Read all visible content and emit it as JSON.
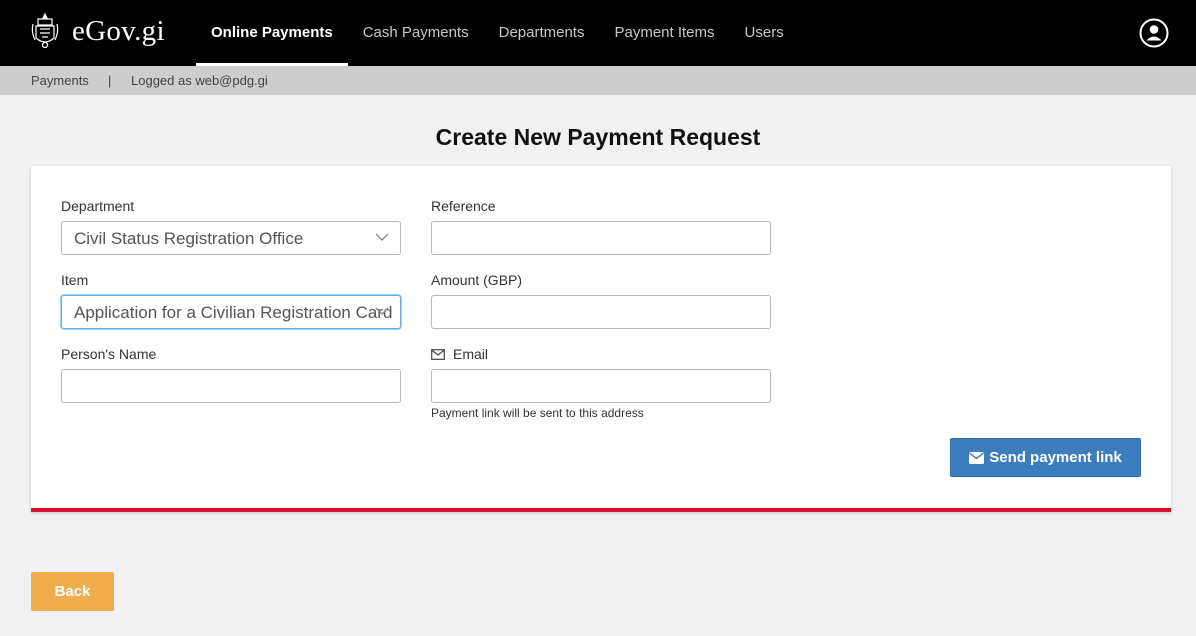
{
  "header": {
    "brand": "eGov.gi",
    "nav": [
      {
        "label": "Online Payments",
        "active": true
      },
      {
        "label": "Cash Payments",
        "active": false
      },
      {
        "label": "Departments",
        "active": false
      },
      {
        "label": "Payment Items",
        "active": false
      },
      {
        "label": "Users",
        "active": false
      }
    ],
    "user_icon": "user-circle-icon"
  },
  "subbar": {
    "section": "Payments",
    "separator": "|",
    "logged_as": "Logged as web@pdg.gi"
  },
  "page": {
    "title": "Create New Payment Request"
  },
  "form": {
    "department": {
      "label": "Department",
      "value": "Civil Status Registration Office"
    },
    "item": {
      "label": "Item",
      "value": "Application for a Civilian Registration Card"
    },
    "person_name": {
      "label": "Person's Name",
      "value": ""
    },
    "reference": {
      "label": "Reference",
      "value": ""
    },
    "amount": {
      "label": "Amount (GBP)",
      "value": ""
    },
    "email": {
      "label": "Email",
      "value": "",
      "help": "Payment link will be sent to this address",
      "icon": "envelope-outline-icon"
    },
    "send_label": "Send payment link",
    "send_icon": "envelope-icon"
  },
  "footer": {
    "back_label": "Back"
  },
  "colors": {
    "topbar": "#000000",
    "accent_red": "#d7102c",
    "primary_blue": "#3b7dbd",
    "back_orange": "#f0ad4e"
  }
}
